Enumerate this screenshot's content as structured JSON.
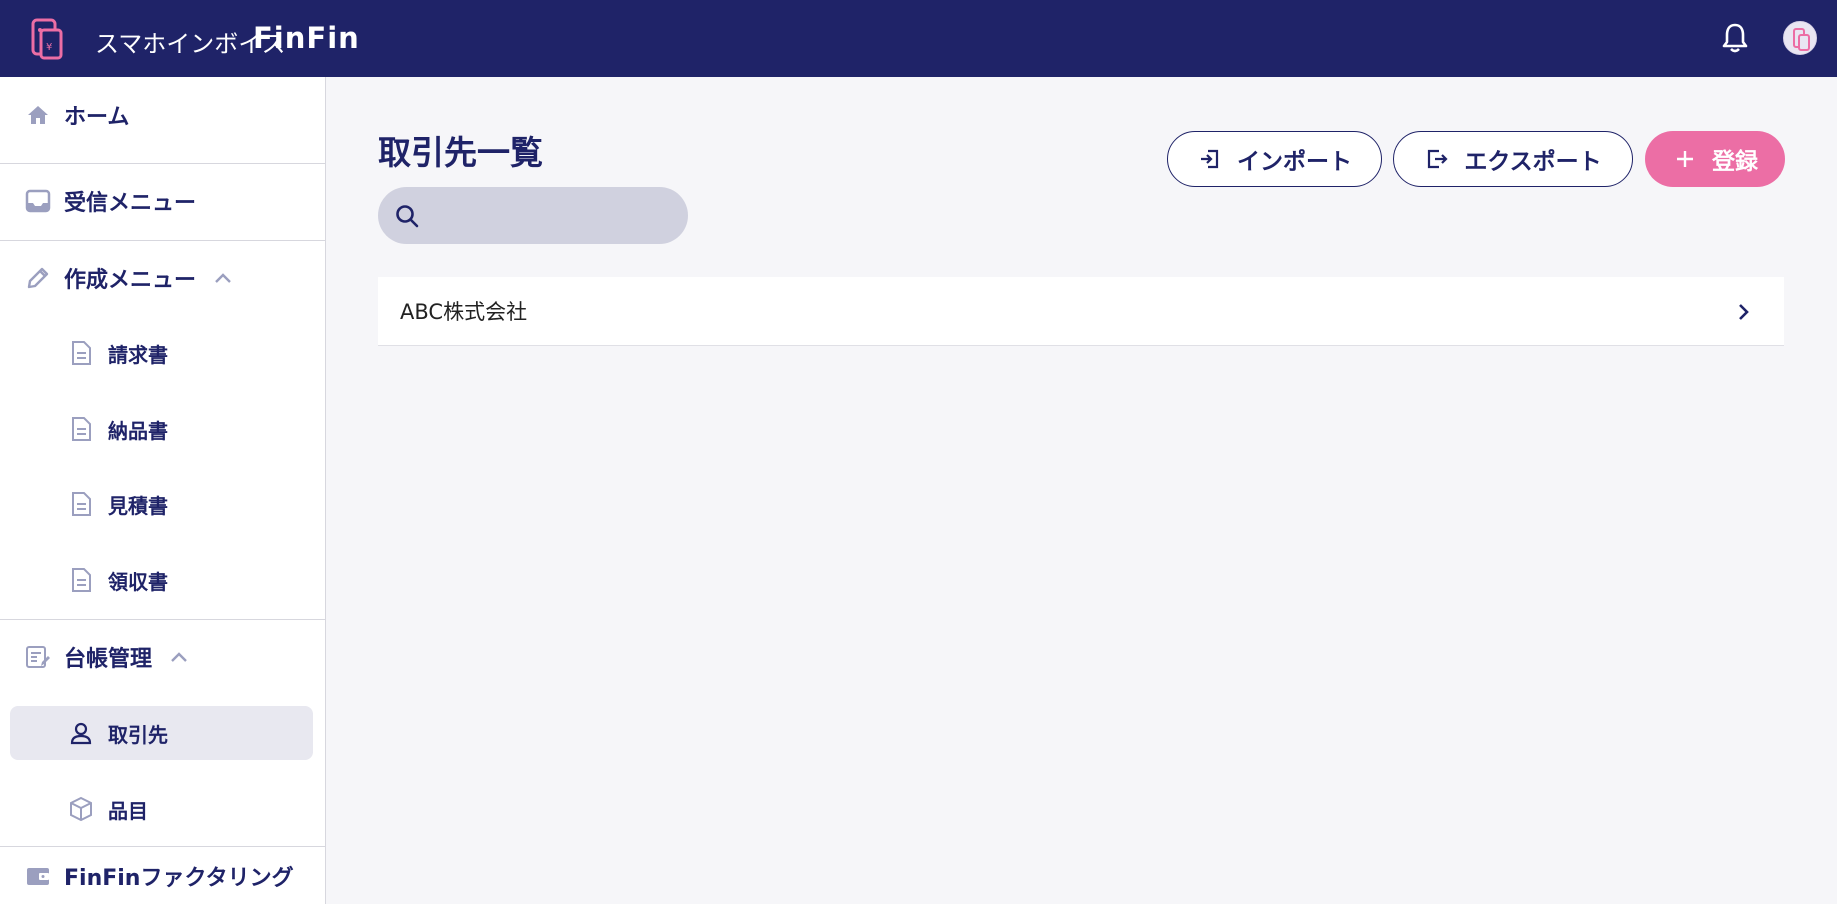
{
  "header": {
    "brand_jp": "スマホインボイス",
    "brand_en": "FinFin"
  },
  "sidebar": {
    "home": "ホーム",
    "inbox": "受信メニュー",
    "create_menu": "作成メニュー",
    "create_items": [
      "請求書",
      "納品書",
      "見積書",
      "領収書"
    ],
    "ledger": "台帳管理",
    "ledger_items": [
      "取引先",
      "品目"
    ],
    "factoring": "FinFinファクタリング"
  },
  "main": {
    "title": "取引先一覧",
    "search_placeholder": "",
    "import_label": "インポート",
    "export_label": "エクスポート",
    "register_label": "登録",
    "rows": [
      "ABC株式会社"
    ]
  },
  "colors": {
    "navy": "#1f2368",
    "pink": "#ec6ea5",
    "search_bg": "#d0d1df",
    "active_bg": "#e8e8f0"
  }
}
